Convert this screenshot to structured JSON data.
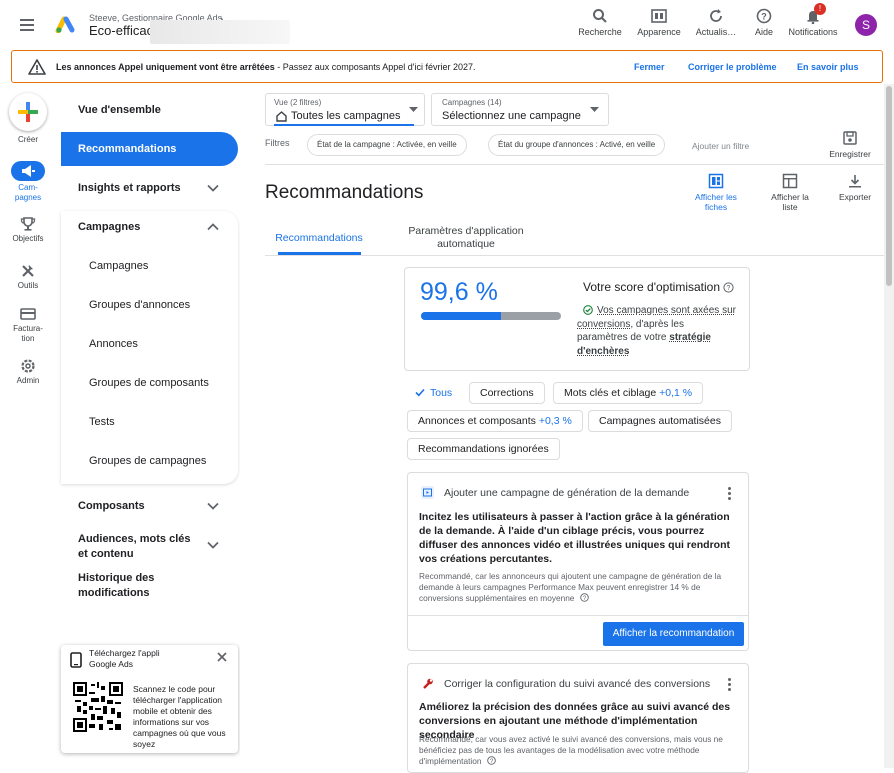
{
  "header": {
    "breadcrumb": "Steeve, Gestionnaire Google Ads",
    "breadcrumb_chevron": "›",
    "account_name": "Eco-efficac",
    "actions": [
      {
        "label": "Recherche",
        "icon": "search-icon"
      },
      {
        "label": "Apparence",
        "icon": "appearance-icon"
      },
      {
        "label": "Actualis…",
        "icon": "refresh-icon"
      },
      {
        "label": "Aide",
        "icon": "help-icon"
      },
      {
        "label": "Notifications",
        "icon": "bell-icon"
      }
    ],
    "notification_badge": "!",
    "avatar_initial": "S"
  },
  "banner": {
    "text_bold": "Les annonces Appel uniquement vont être arrêtées",
    "text_rest": " - Passez aux composants Appel d'ici février 2027.",
    "buttons": [
      "Fermer",
      "Corriger le problème",
      "En savoir plus"
    ]
  },
  "rail": {
    "create": "Créer",
    "items": [
      {
        "label": "Cam-pagnes",
        "icon": "megaphone-icon"
      },
      {
        "label": "Objectifs",
        "icon": "trophy-icon"
      },
      {
        "label": "Outils",
        "icon": "tools-icon"
      },
      {
        "label": "Factura-tion",
        "icon": "billing-icon"
      },
      {
        "label": "Admin",
        "icon": "gear-icon"
      }
    ]
  },
  "nav": {
    "overview": "Vue d'ensemble",
    "recommendations": "Recommandations",
    "insights": "Insights et rapports",
    "campaigns": "Campagnes",
    "campaigns_sub": [
      "Campagnes",
      "Groupes d'annonces",
      "Annonces",
      "Groupes de composants",
      "Tests",
      "Groupes de campagnes"
    ],
    "assets": "Composants",
    "audiences": "Audiences, mots clés et contenu",
    "history": "Historique des modifications"
  },
  "download_card": {
    "title": "Téléchargez l'appli Google Ads",
    "text": "Scannez le code pour télécharger l'application mobile et obtenir des informations sur vos campagnes où que vous soyez"
  },
  "toolbar": {
    "view_small": "Vue (2 filtres)",
    "view_value": "Toutes les campagnes",
    "campaign_small": "Campagnes (14)",
    "campaign_value": "Sélectionnez une campagne",
    "filters_label": "Filtres",
    "filter_chips": [
      "État de la campagne : Activée, en veille",
      "État du groupe d'annonces : Activé, en veille"
    ],
    "add_filter": "Ajouter un filtre",
    "save": "Enregistrer",
    "page_title": "Recommandations",
    "view_actions": [
      {
        "label": "Afficher les fiches",
        "icon": "cards-icon"
      },
      {
        "label": "Afficher la liste",
        "icon": "list-icon"
      },
      {
        "label": "Exporter",
        "icon": "download-icon"
      }
    ],
    "tabs": [
      "Recommandations",
      "Paramètres d'application automatique"
    ]
  },
  "score": {
    "value": "99,6 %",
    "progress": 0.996,
    "title": "Votre score d'optimisation",
    "desc_link1": "Vos campagnes sont axées sur conversions",
    "desc_mid": ", d'après les paramètres de votre ",
    "desc_link2": "stratégie d'enchères"
  },
  "filters": [
    {
      "label": "Tous",
      "uplift": ""
    },
    {
      "label": "Corrections",
      "uplift": ""
    },
    {
      "label": "Mots clés et ciblage",
      "uplift": "+0,1 %"
    },
    {
      "label": "Annonces et composants",
      "uplift": "+0,3 %"
    },
    {
      "label": "Campagnes automatisées",
      "uplift": ""
    },
    {
      "label": "Recommandations ignorées",
      "uplift": ""
    }
  ],
  "rec1": {
    "header": "Ajouter une campagne de génération de la demande",
    "title": "Incitez les utilisateurs à passer à l'action grâce à la génération de la demande. À l'aide d'un ciblage précis, vous pourrez diffuser des annonces vidéo et illustrées uniques qui rendront vos créations percutantes.",
    "note": "Recommandé, car les annonceurs qui ajoutent une campagne de génération de la demande à leurs campagnes Performance Max peuvent enregistrer 14 % de conversions supplémentaires en moyenne",
    "button": "Afficher la recommandation"
  },
  "rec2": {
    "header": "Corriger la configuration du suivi avancé des conversions",
    "title": "Améliorez la précision des données grâce au suivi avancé des conversions en ajoutant une méthode d'implémentation secondaire",
    "note": "Recommandé, car vous avez activé le suivi avancé des conversions, mais vous ne bénéficiez pas de tous les avantages de la modélisation avec votre méthode d'implémentation"
  },
  "colors": {
    "accent": "#1a73e8",
    "warning": "#e8710a",
    "avatar": "#8e24aa"
  }
}
